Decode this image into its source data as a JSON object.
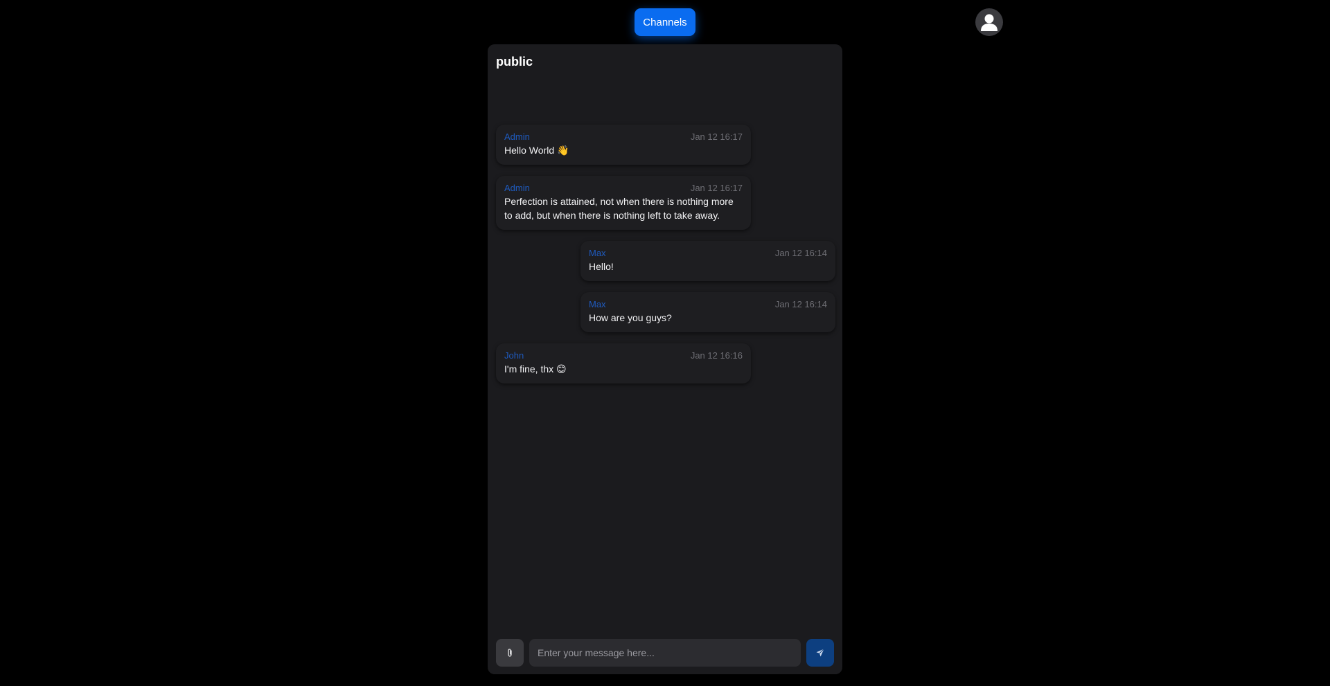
{
  "header": {
    "channels_button_label": "Channels",
    "avatar_icon": "user-icon"
  },
  "channel": {
    "name": "public"
  },
  "messages": [
    {
      "author": "Admin",
      "time": "Jan 12 16:17",
      "text": "Hello World 👋",
      "side": "left"
    },
    {
      "author": "Admin",
      "time": "Jan 12 16:17",
      "text": "Perfection is attained, not when there is nothing more to add, but when there is nothing left to take away.",
      "side": "left"
    },
    {
      "author": "Max",
      "time": "Jan 12 16:14",
      "text": "Hello!",
      "side": "right"
    },
    {
      "author": "Max",
      "time": "Jan 12 16:14",
      "text": "How are you guys?",
      "side": "right"
    },
    {
      "author": "John",
      "time": "Jan 12 16:16",
      "text": "I'm fine, thx 😊",
      "side": "left"
    }
  ],
  "composer": {
    "placeholder": "Enter your message here...",
    "value": "",
    "attach_icon": "paperclip-icon",
    "send_icon": "send-icon"
  },
  "colors": {
    "accent": "#0a6cf0",
    "author": "#1f5bbf",
    "panel": "#1b1b1e",
    "background": "#000000"
  }
}
